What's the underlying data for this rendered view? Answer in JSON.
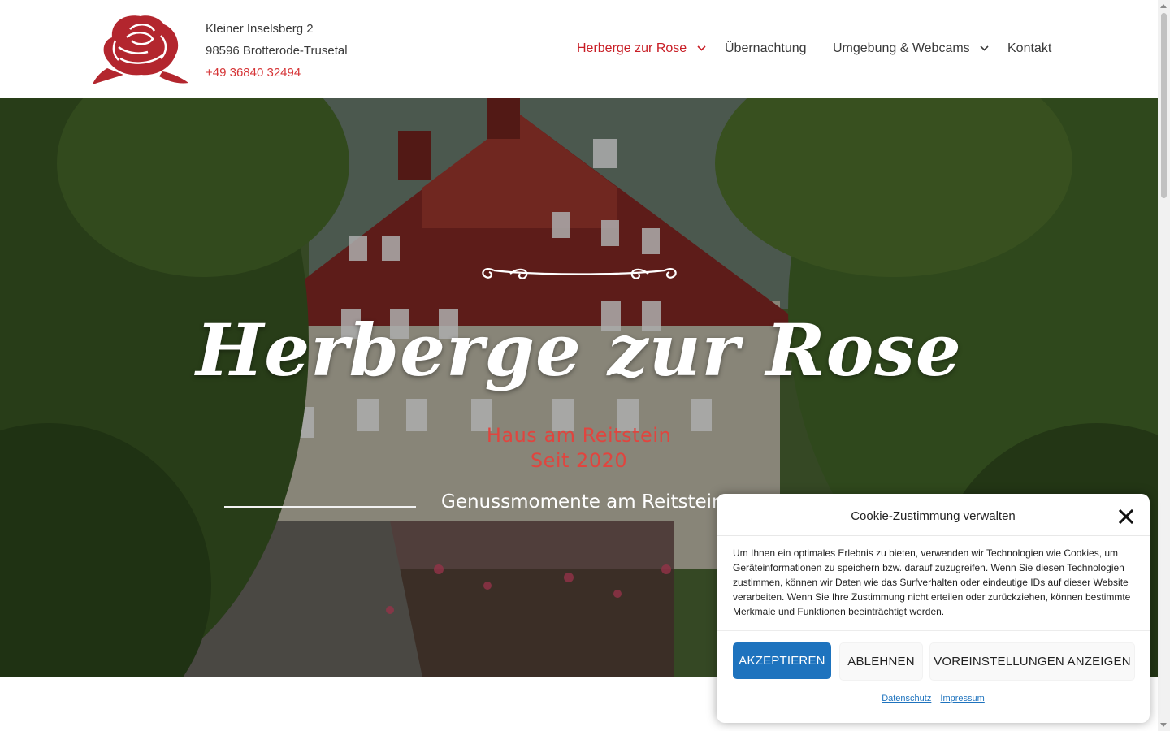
{
  "header": {
    "address_line1": "Kleiner Inselsberg 2",
    "address_line2": "98596 Brotterode-Trusetal",
    "phone": "+49 36840 32494",
    "logo": "rose-logo"
  },
  "nav": {
    "items": [
      {
        "label": "Herberge zur Rose",
        "active": true,
        "has_dropdown": true
      },
      {
        "label": "Übernachtung",
        "active": false,
        "has_dropdown": false
      },
      {
        "label": "Umgebung & Webcams",
        "active": false,
        "has_dropdown": true
      },
      {
        "label": "Kontakt",
        "active": false,
        "has_dropdown": false
      }
    ]
  },
  "hero": {
    "title": "Herberge zur Rose",
    "subtitle_line1": "Haus am Reitstein",
    "subtitle_line2": "Seit 2020",
    "tagline": "Genussmomente am Reitstein"
  },
  "cookie": {
    "title": "Cookie-Zustimmung verwalten",
    "text": "Um Ihnen ein optimales Erlebnis zu bieten, verwenden wir Technologien wie Cookies, um Geräteinformationen zu speichern bzw. darauf zuzugreifen. Wenn Sie diesen Technologien zustimmen, können wir Daten wie das Surfverhalten oder eindeutige IDs auf dieser Website verarbeiten. Wenn Sie Ihre Zustimmung nicht erteilen oder zurückziehen, können bestimmte Merkmale und Funktionen beeinträchtigt werden.",
    "accept_label": "AKZEPTIEREN",
    "deny_label": "ABLEHNEN",
    "prefs_label": "VOREINSTELLUNGEN ANZEIGEN",
    "link_privacy": "Datenschutz",
    "link_imprint": "Impressum"
  },
  "colors": {
    "accent_red": "#c81d25",
    "subtitle_red": "#e0453f",
    "button_blue": "#1e73be"
  }
}
